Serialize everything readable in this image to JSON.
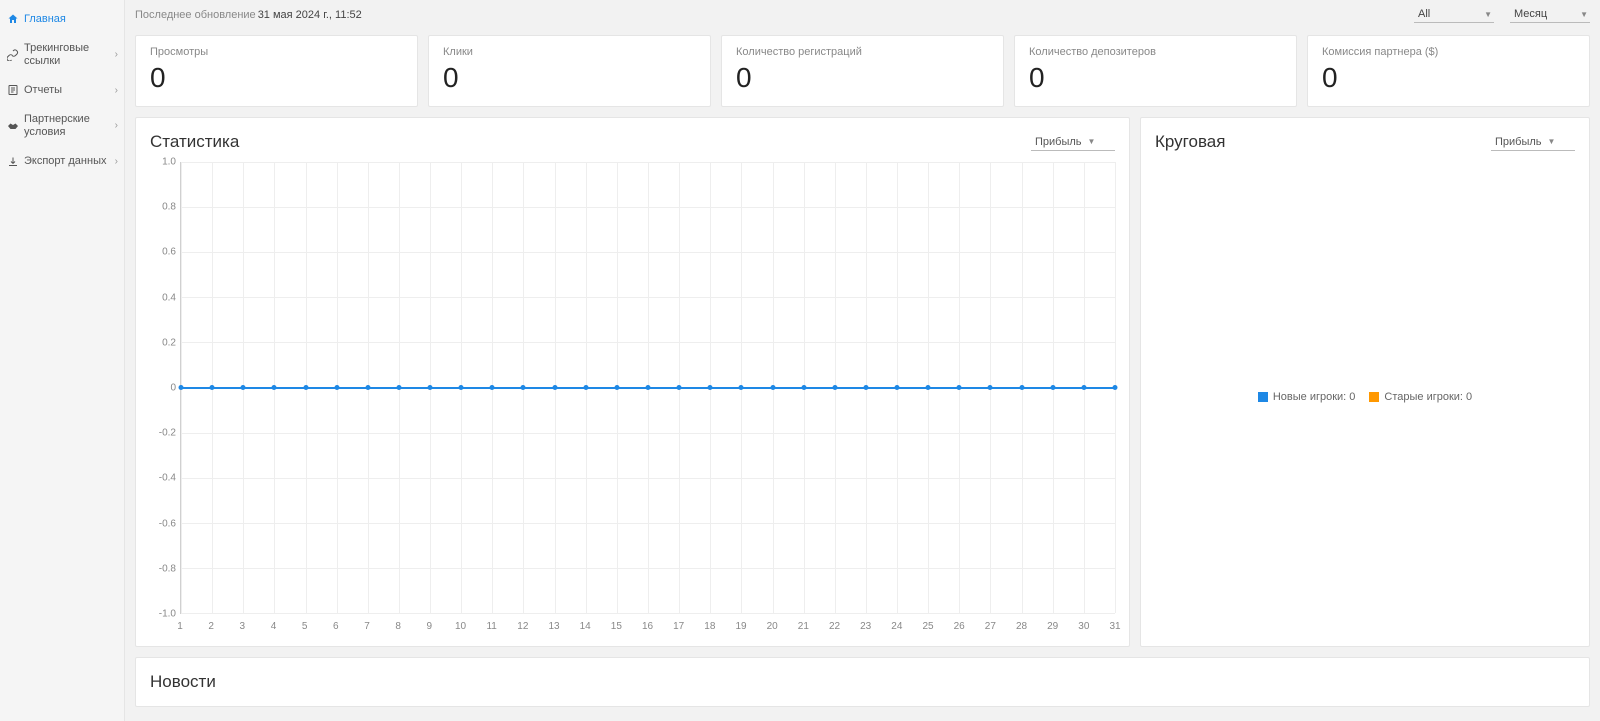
{
  "sidebar": {
    "items": [
      {
        "label": "Главная",
        "icon": "home",
        "active": true,
        "hasChevron": false
      },
      {
        "label": "Трекинговые ссылки",
        "icon": "link",
        "active": false,
        "hasChevron": true
      },
      {
        "label": "Отчеты",
        "icon": "report",
        "active": false,
        "hasChevron": true
      },
      {
        "label": "Партнерские условия",
        "icon": "handshake",
        "active": false,
        "hasChevron": true
      },
      {
        "label": "Экспорт данных",
        "icon": "download",
        "active": false,
        "hasChevron": true
      }
    ]
  },
  "topbar": {
    "updated_label": "Последнее обновление",
    "updated_value": "31 мая 2024 г., 11:52",
    "filter_all": "All",
    "filter_period": "Месяц"
  },
  "kpis": [
    {
      "title": "Просмотры",
      "value": "0"
    },
    {
      "title": "Клики",
      "value": "0"
    },
    {
      "title": "Количество регистраций",
      "value": "0"
    },
    {
      "title": "Количество депозитеров",
      "value": "0"
    },
    {
      "title": "Комиссия партнера ($)",
      "value": "0"
    }
  ],
  "stats_panel": {
    "title": "Статистика",
    "select": "Прибыль"
  },
  "pie_panel": {
    "title": "Круговая",
    "select": "Прибыль",
    "legend": [
      {
        "label": "Новые игроки: 0",
        "color": "#1e88e5"
      },
      {
        "label": "Старые игроки: 0",
        "color": "#ff9800"
      }
    ]
  },
  "news_panel": {
    "title": "Новости"
  },
  "chart_data": {
    "type": "line",
    "title": "Статистика",
    "xlabel": "",
    "ylabel": "",
    "ylim": [
      -1.0,
      1.0
    ],
    "y_ticks": [
      1.0,
      0.8,
      0.6,
      0.4,
      0.2,
      0,
      -0.2,
      -0.4,
      -0.6,
      -0.8,
      -1.0
    ],
    "categories": [
      1,
      2,
      3,
      4,
      5,
      6,
      7,
      8,
      9,
      10,
      11,
      12,
      13,
      14,
      15,
      16,
      17,
      18,
      19,
      20,
      21,
      22,
      23,
      24,
      25,
      26,
      27,
      28,
      29,
      30,
      31
    ],
    "series": [
      {
        "name": "Прибыль",
        "color": "#1e88e5",
        "values": [
          0,
          0,
          0,
          0,
          0,
          0,
          0,
          0,
          0,
          0,
          0,
          0,
          0,
          0,
          0,
          0,
          0,
          0,
          0,
          0,
          0,
          0,
          0,
          0,
          0,
          0,
          0,
          0,
          0,
          0,
          0
        ]
      }
    ]
  }
}
